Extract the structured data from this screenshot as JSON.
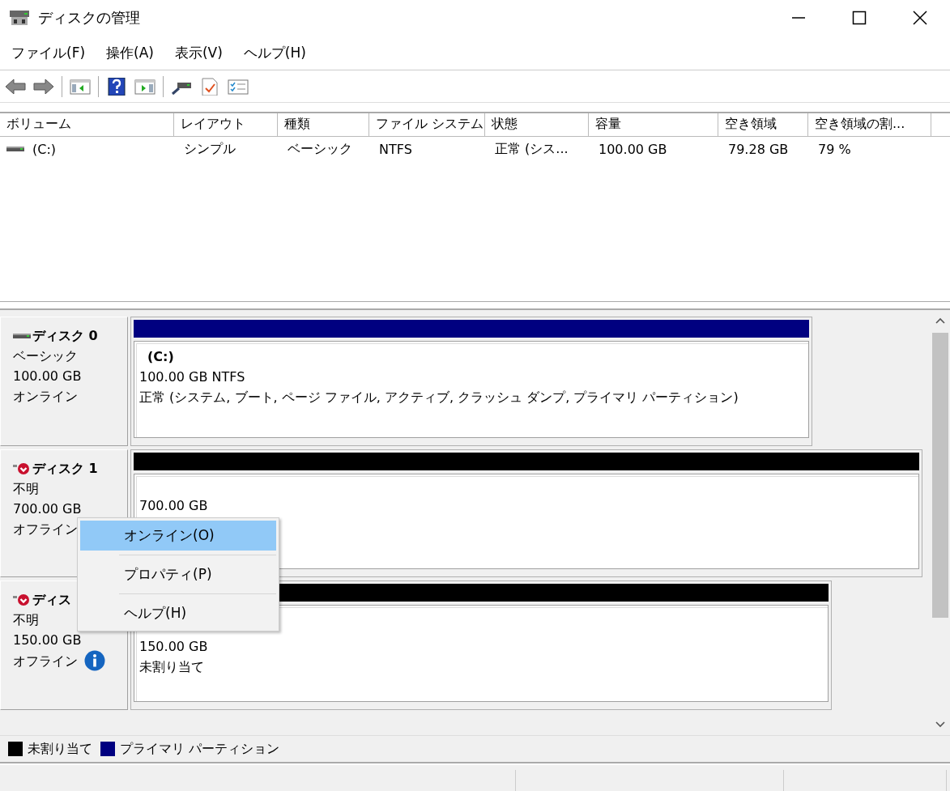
{
  "window": {
    "title": "ディスクの管理"
  },
  "menu_bar": [
    "ファイル(F)",
    "操作(A)",
    "表示(V)",
    "ヘルプ(H)"
  ],
  "volume_table": {
    "columns": [
      "ボリューム",
      "レイアウト",
      "種類",
      "ファイル システム",
      "状態",
      "容量",
      "空き領域",
      "空き領域の割..."
    ],
    "rows": [
      {
        "cells": [
          "(C:)",
          "シンプル",
          "ベーシック",
          "NTFS",
          "正常 (シス...",
          "100.00 GB",
          "79.28 GB",
          "79 %"
        ]
      }
    ]
  },
  "disks": [
    {
      "name": "ディスク 0",
      "offline": false,
      "info": false,
      "lines": [
        "ベーシック",
        "100.00 GB",
        "オンライン"
      ],
      "partitions": [
        {
          "kind": "primary",
          "title": "(C:)",
          "lines": [
            "100.00 GB NTFS",
            "正常 (システム, ブート, ページ ファイル, アクティブ, クラッシュ ダンプ, プライマリ パーティション)"
          ]
        }
      ]
    },
    {
      "name": "ディスク 1",
      "offline": true,
      "info": false,
      "lines": [
        "不明",
        "700.00 GB",
        "オフライン"
      ],
      "partitions": [
        {
          "kind": "unallocated",
          "lines": [
            "700.00 GB"
          ]
        }
      ]
    },
    {
      "name": "ディス",
      "offline": true,
      "info": true,
      "lines": [
        "不明",
        "150.00 GB",
        "オフライン"
      ],
      "partitions": [
        {
          "kind": "unallocated",
          "lines": [
            "150.00 GB",
            "未割り当て"
          ]
        }
      ]
    }
  ],
  "context_menu": [
    {
      "label": "オンライン(O)",
      "selected": true
    },
    {
      "label": "プロパティ(P)",
      "selected": false
    },
    {
      "label": "ヘルプ(H)",
      "selected": false
    }
  ],
  "legend": [
    {
      "label": "未割り当て",
      "color": "#000000"
    },
    {
      "label": "プライマリ パーティション",
      "color": "#000080"
    }
  ]
}
